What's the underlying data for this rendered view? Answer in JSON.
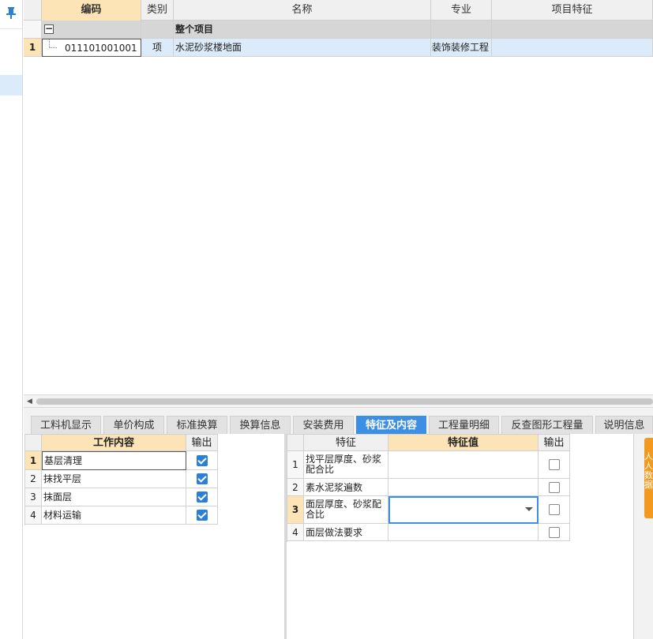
{
  "top_grid": {
    "headers": [
      "编码",
      "类别",
      "名称",
      "专业",
      "项目特征"
    ],
    "group_row": {
      "label": "整个项目"
    },
    "rows": [
      {
        "row_no": "1",
        "code": "011101001001",
        "type": "项",
        "name": "水泥砂浆楼地面",
        "specialty": "装饰装修工程",
        "feature": ""
      }
    ]
  },
  "tabs": [
    {
      "label": "工料机显示",
      "active": false
    },
    {
      "label": "单价构成",
      "active": false
    },
    {
      "label": "标准换算",
      "active": false
    },
    {
      "label": "换算信息",
      "active": false
    },
    {
      "label": "安装费用",
      "active": false
    },
    {
      "label": "特征及内容",
      "active": true
    },
    {
      "label": "工程量明细",
      "active": false
    },
    {
      "label": "反查图形工程量",
      "active": false
    },
    {
      "label": "说明信息",
      "active": false
    }
  ],
  "work_content": {
    "headers": [
      "工作内容",
      "输出"
    ],
    "rows": [
      {
        "no": "1",
        "label": "基层清理",
        "checked": true
      },
      {
        "no": "2",
        "label": "抹找平层",
        "checked": true
      },
      {
        "no": "3",
        "label": "抹面层",
        "checked": true
      },
      {
        "no": "4",
        "label": "材料运输",
        "checked": true
      }
    ]
  },
  "features": {
    "headers": [
      "特征",
      "特征值",
      "输出"
    ],
    "rows": [
      {
        "no": "1",
        "label": "找平层厚度、砂浆配合比",
        "value": "",
        "checked": false
      },
      {
        "no": "2",
        "label": "素水泥浆遍数",
        "value": "",
        "checked": false
      },
      {
        "no": "3",
        "label": "面层厚度、砂浆配合比",
        "value": "",
        "checked": false
      },
      {
        "no": "4",
        "label": "面层做法要求",
        "value": "",
        "checked": false
      }
    ]
  },
  "side_tab": {
    "label": "人人数据"
  },
  "colors": {
    "accent": "#3d8fe3",
    "header_highlight": "#fde4b6",
    "selection": "#dcebf9",
    "orange": "#f39a1e"
  }
}
